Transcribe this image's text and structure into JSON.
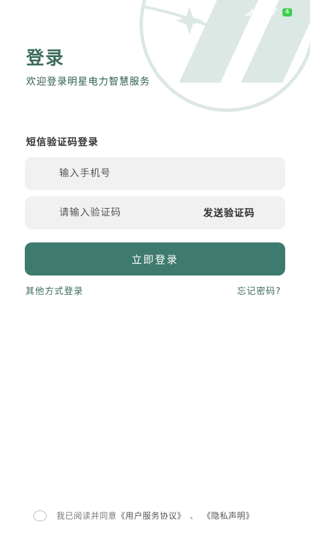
{
  "status": {
    "battery": "4"
  },
  "header": {
    "title": "登录",
    "subtitle": "欢迎登录明星电力智慧服务"
  },
  "form": {
    "section_label": "短信验证码登录",
    "phone_placeholder": "输入手机号",
    "code_placeholder": "请输入验证码",
    "send_code_label": "发送验证码",
    "login_label": "立即登录"
  },
  "links": {
    "other_login": "其他方式登录",
    "forgot_password": "忘记密码?"
  },
  "agreement": {
    "prefix": "我已阅读并同意",
    "user_agreement": "《用户服务协议》",
    "separator": "、",
    "privacy": "《隐私声明》"
  },
  "colors": {
    "primary": "#3f7a6e",
    "title": "#3d6b5e",
    "field_bg": "#f1f1f1",
    "watermark": "#dce8e3"
  }
}
